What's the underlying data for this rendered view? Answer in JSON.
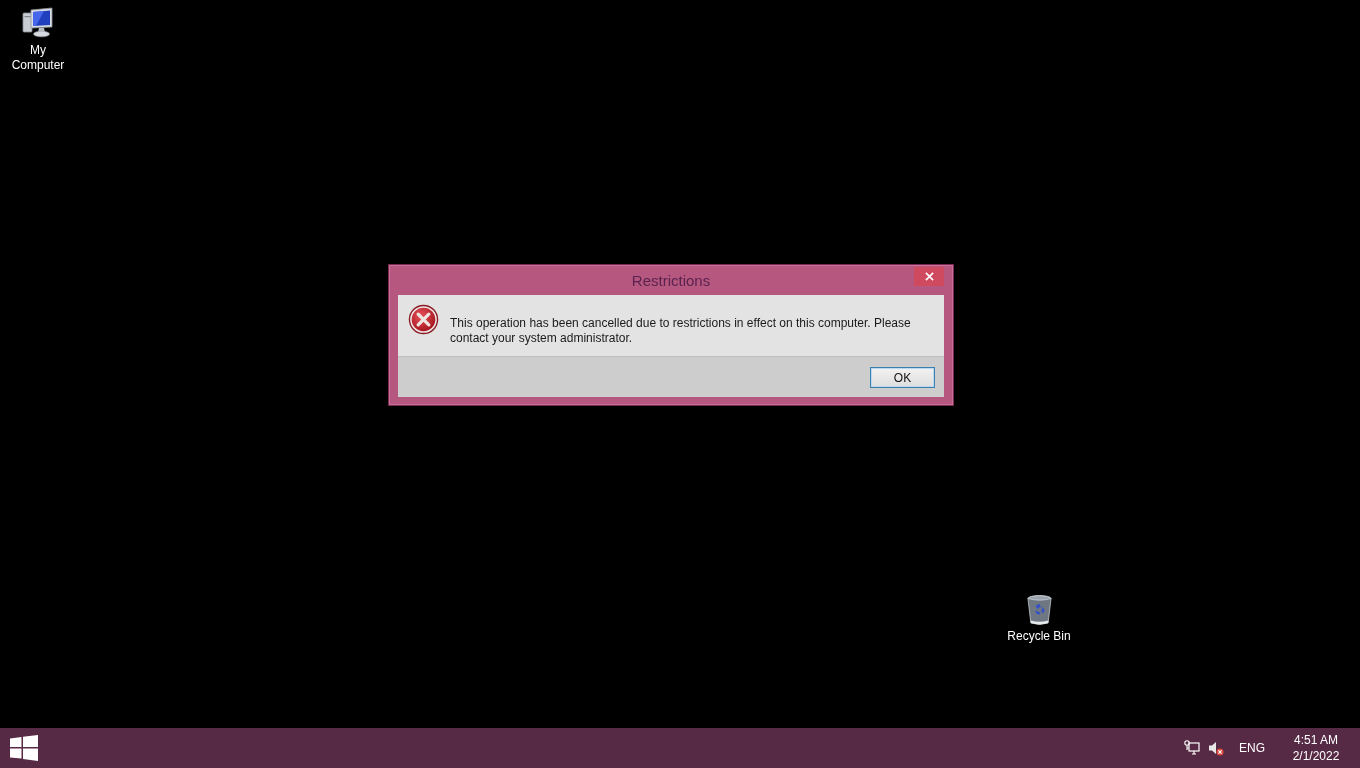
{
  "desktop_icons": [
    {
      "label": "My Computer",
      "kind": "computer"
    },
    {
      "label": "Recycle Bin",
      "kind": "recycle-bin"
    }
  ],
  "dialog": {
    "title": "Restrictions",
    "message": "This operation has been cancelled due to restrictions in effect on this computer. Please contact your system administrator.",
    "buttons": [
      {
        "label": "OK",
        "focused": true
      }
    ]
  },
  "taskbar": {
    "tray": {
      "volume_muted": true,
      "language": "ENG",
      "time": "4:51 AM",
      "date": "2/1/2022"
    }
  }
}
